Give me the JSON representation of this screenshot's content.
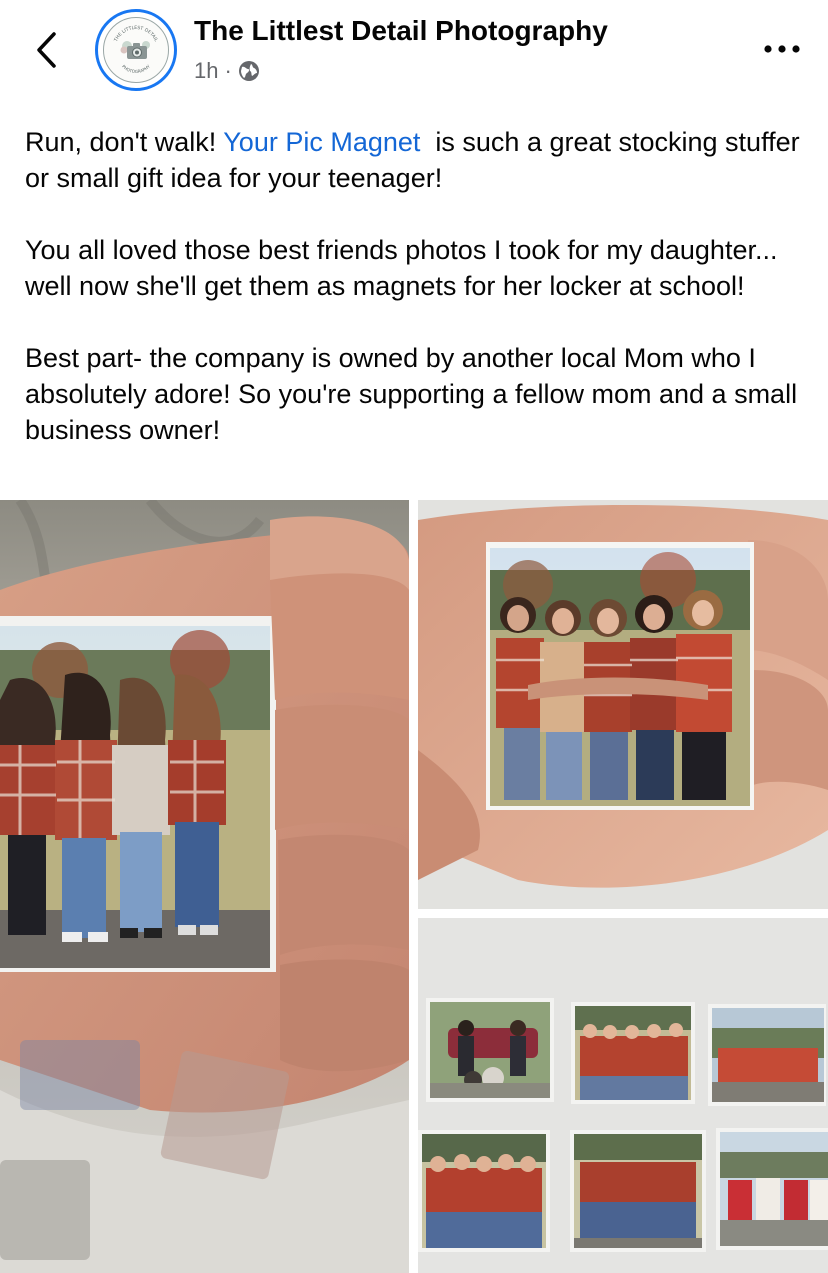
{
  "header": {
    "back_icon": "chevron-left-icon",
    "page_name": "The Littlest Detail Photography",
    "time": "1h",
    "separator": "·",
    "audience_icon": "globe-icon",
    "more_icon": "more-horizontal-icon",
    "avatar_text_top": "THE LITTLEST DETAIL",
    "avatar_text_bottom": "PHOTOGRAPHY"
  },
  "post": {
    "p1_before": "Run, don't walk! ",
    "p1_mention": "Your Pic Magnet",
    "p1_after": "  is such a great stocking stuffer or small gift idea for your teenager!",
    "p2": "You all loved those best friends photos I took for my daughter... well now she'll get them as magnets for her locker at school!",
    "p3": "Best part- the company is owned by another local Mom who I absolutely adore! So you're supporting a fellow mom and a small business owner!"
  },
  "colors": {
    "link": "#1467d6",
    "avatar_ring": "#1877f2",
    "meta_text": "#65676b"
  },
  "photos": [
    {
      "name": "photo-magnet-hand-back-view"
    },
    {
      "name": "photo-magnet-hand-front-view"
    },
    {
      "name": "photo-magnet-collection-grid"
    }
  ]
}
